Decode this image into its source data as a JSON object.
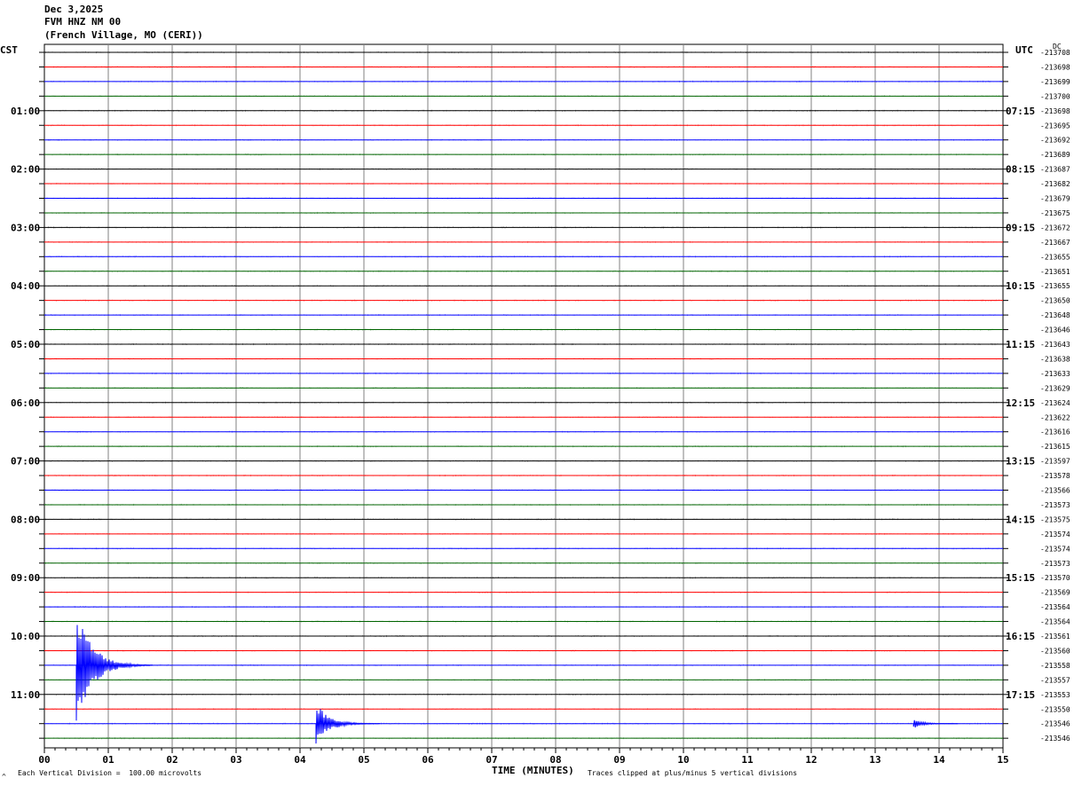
{
  "header": {
    "date": "Dec 3,2025",
    "station": "FVM HNZ NM 00",
    "location": "(French Village, MO (CERI))"
  },
  "left_tz": "CST",
  "right_tz": "UTC",
  "dc_label": "DC",
  "footer": {
    "xlabel": "TIME (MINUTES)",
    "scale_note": "Each Vertical Division =  100.00 microvolts",
    "clip_note": "Traces clipped at plus/minus 5 vertical divisions",
    "corner_mark": "^"
  },
  "colors": {
    "trace_cycle": [
      "#000000",
      "#ff0000",
      "#0000ff",
      "#006400"
    ],
    "grid": "#808080"
  },
  "chart_data": {
    "type": "line",
    "title": "FVM HNZ NM 00",
    "xlabel": "TIME (MINUTES)",
    "xlim": [
      0,
      15
    ],
    "x_ticks": [
      "00",
      "01",
      "02",
      "03",
      "04",
      "05",
      "06",
      "07",
      "08",
      "09",
      "10",
      "11",
      "12",
      "13",
      "14",
      "15"
    ],
    "left_hour_labels": [
      "01:00",
      "02:00",
      "03:00",
      "04:00",
      "05:00",
      "06:00",
      "07:00",
      "08:00",
      "09:00",
      "10:00",
      "11:00"
    ],
    "right_hour_labels": [
      "07:15",
      "08:15",
      "09:15",
      "10:15",
      "11:15",
      "12:15",
      "13:15",
      "14:15",
      "15:15",
      "16:15",
      "17:15"
    ],
    "trace_count": 48,
    "dc_offsets": [
      "-213708",
      "-213698",
      "-213699",
      "-213700",
      "-213698",
      "-213695",
      "-213692",
      "-213689",
      "-213687",
      "-213682",
      "-213679",
      "-213675",
      "-213672",
      "-213667",
      "-213655",
      "-213651",
      "-213655",
      "-213650",
      "-213648",
      "-213646",
      "-213643",
      "-213638",
      "-213633",
      "-213629",
      "-213624",
      "-213622",
      "-213616",
      "-213615",
      "-213597",
      "-213578",
      "-213566",
      "-213573",
      "-213575",
      "-213574",
      "-213574",
      "-213573",
      "-213570",
      "-213569",
      "-213564",
      "-213564",
      "-213561",
      "-213560",
      "-213558",
      "-213557",
      "-213553",
      "-213550",
      "-213546",
      "-213546"
    ],
    "events": [
      {
        "trace": 42,
        "minute": 0.5,
        "amplitude_divisions": 5.0,
        "duration_minutes": 1.2
      },
      {
        "trace": 46,
        "minute": 4.25,
        "amplitude_divisions": 1.8,
        "duration_minutes": 1.0
      },
      {
        "trace": 46,
        "minute": 13.6,
        "amplitude_divisions": 0.4,
        "duration_minutes": 0.7
      }
    ],
    "vertical_division_microvolts": 100.0,
    "clip_divisions": 5
  }
}
